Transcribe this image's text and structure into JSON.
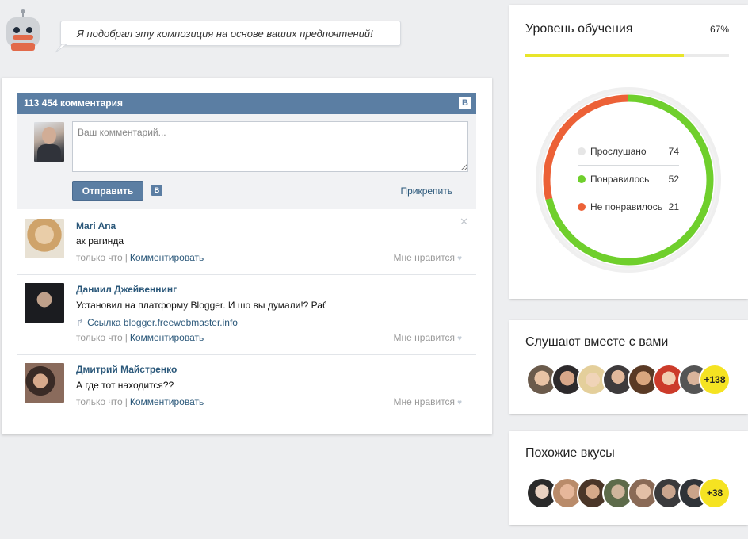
{
  "assistant": {
    "message": "Я подобрал эту композиция на основе ваших предпочтений!"
  },
  "comments_widget": {
    "count_label": "113 454 комментария",
    "vk_badge": "В",
    "placeholder": "Ваш комментарий...",
    "send_label": "Отправить",
    "vk_small": "В",
    "attach_label": "Прикрепить",
    "comments": [
      {
        "author": "Mari Ana",
        "text": "ак рагинда",
        "time": "только что",
        "reply": "Комментировать",
        "like": "Мне нравится",
        "close": "✕"
      },
      {
        "author": "Даниил Джейвеннинг",
        "text": "Установил на платформу Blogger. И шо вы думали!? Раб",
        "link_prefix": "Ссылка",
        "link": "blogger.freewebmaster.info",
        "time": "только что",
        "reply": "Комментировать",
        "like": "Мне нравится"
      },
      {
        "author": "Дмитрий Майстренко",
        "text": "А где тот находится??",
        "time": "только что",
        "reply": "Комментировать",
        "like": "Мне нравится"
      }
    ]
  },
  "learning": {
    "title": "Уровень обучения",
    "percent_label": "67%",
    "progress": 0.78,
    "stats": [
      {
        "label": "Прослушано",
        "value": "74",
        "color": "#e6e6e6"
      },
      {
        "label": "Понравилось",
        "value": "52",
        "color": "#6fcf2c"
      },
      {
        "label": "Не понравилось",
        "value": "21",
        "color": "#ec6137"
      }
    ],
    "ring": {
      "liked": 52,
      "disliked": 21
    }
  },
  "listening": {
    "title": "Слушают вместе с вами",
    "more": "+138"
  },
  "tastes": {
    "title": "Похожие вкусы",
    "more": "+38"
  },
  "colors": {
    "vk_blue": "#5b7ea3",
    "progress_yellow": "#e8e52a",
    "liked_green": "#6fcf2c",
    "disliked_orange": "#ec6137"
  }
}
